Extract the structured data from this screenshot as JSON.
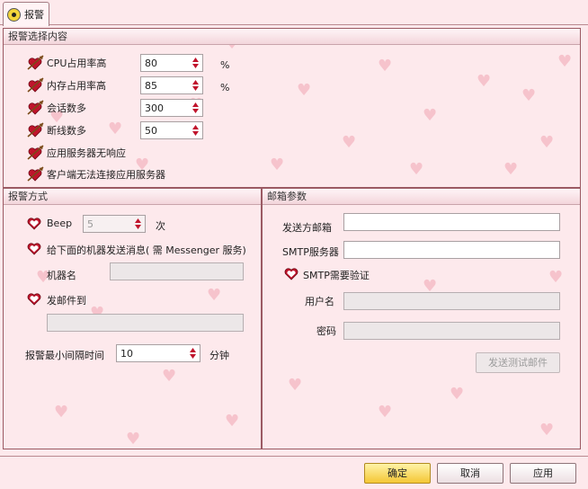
{
  "tab": {
    "label": "报警"
  },
  "alarm_content": {
    "title": "报警选择内容",
    "items": [
      {
        "label": "CPU占用率高",
        "value": "80",
        "unit": "%"
      },
      {
        "label": "内存占用率高",
        "value": "85",
        "unit": "%"
      },
      {
        "label": "会话数多",
        "value": "300",
        "unit": ""
      },
      {
        "label": "断线数多",
        "value": "50",
        "unit": ""
      },
      {
        "label": "应用服务器无响应"
      },
      {
        "label": "客户端无法连接应用服务器"
      }
    ]
  },
  "alarm_method": {
    "title": "报警方式",
    "beep_label": "Beep",
    "beep_value": "5",
    "beep_unit": "次",
    "messenger_label": "给下面的机器发送消息( 需 Messenger 服务)",
    "machine_label": "机器名",
    "mail_to_label": "发邮件到",
    "min_interval_label": "报警最小间隔时间",
    "min_interval_value": "10",
    "min_interval_unit": "分钟"
  },
  "mail_params": {
    "title": "邮箱参数",
    "sender_label": "发送方邮箱",
    "smtp_server_label": "SMTP服务器",
    "smtp_auth_label": "SMTP需要验证",
    "username_label": "用户名",
    "password_label": "密码",
    "test_button": "发送测试邮件"
  },
  "footer": {
    "ok": "确定",
    "cancel": "取消",
    "apply": "应用"
  },
  "colors": {
    "accent": "#c0142c",
    "frame": "#9b5a63",
    "background": "#fde9ec"
  }
}
